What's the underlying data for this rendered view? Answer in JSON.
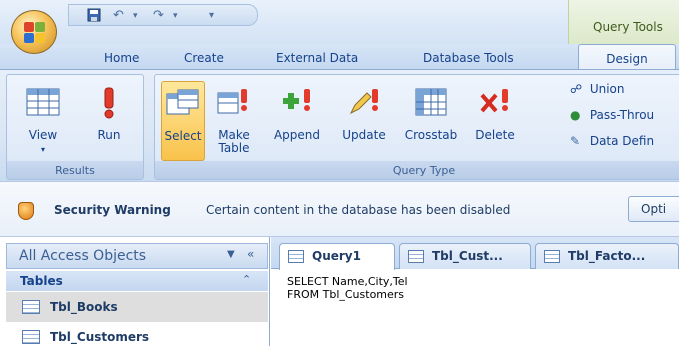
{
  "title_bar": {
    "context_title": "Query Tools"
  },
  "tabs": [
    "Home",
    "Create",
    "External Data",
    "Database Tools"
  ],
  "active_tab": "Design",
  "ribbon": {
    "results_group": {
      "label": "Results",
      "buttons": [
        {
          "label": "View"
        },
        {
          "label": "Run"
        }
      ]
    },
    "query_type_group": {
      "label": "Query Type",
      "buttons": [
        {
          "label": "Select",
          "active": true
        },
        {
          "label": "Make Table"
        },
        {
          "label": "Append"
        },
        {
          "label": "Update"
        },
        {
          "label": "Crosstab"
        },
        {
          "label": "Delete"
        }
      ],
      "small_buttons": [
        {
          "label": "Union"
        },
        {
          "label": "Pass-Throu"
        },
        {
          "label": "Data Defin"
        }
      ]
    }
  },
  "security_bar": {
    "title": "Security Warning",
    "message": "Certain content in the database has been disabled",
    "options_button": "Opti"
  },
  "nav_pane": {
    "title": "All Access Objects",
    "group_label": "Tables",
    "items": [
      "Tbl_Books",
      "Tbl_Customers"
    ]
  },
  "doc_tabs": [
    "Query1",
    "Tbl_Cust...",
    "Tbl_Facto..."
  ],
  "sql_lines": [
    "SELECT Name,City,Tel",
    "FROM Tbl_Customers"
  ],
  "colors": {
    "accent": "#15428b",
    "active_button": "#f9c24b"
  }
}
